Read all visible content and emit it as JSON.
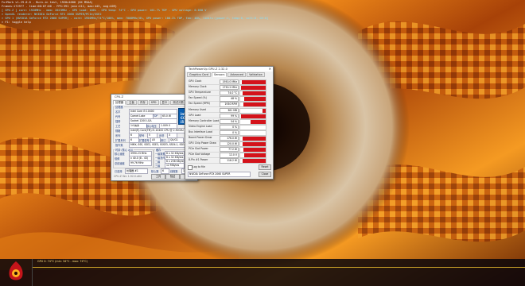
{
  "overlay": [
    {
      "text": "FurMark v1.29.0.0 - Burn-in test, 1920x1080 (0X MSAA)",
      "color": "white"
    },
    {
      "text": "Frames:172977 - time:00:07:00 - FPS:391 (min:411, max:443, avg:409)",
      "color": "white"
    },
    {
      "text": "[ GPU-Z ] core: 1920MHz - mem: 2023MHz - GPU load: 100% - GPU temp: 74°C - GPU power: 101.7% TDP - GPU voltage: 0.050 V",
      "color": "cyan"
    },
    {
      "text": "> OpenGL renderer: NVIDIA GeForce RTX 2060 SUPER/PCIe/SSE2",
      "color": "cyan"
    },
    {
      "text": "> GPU 1 (NVIDIA GeForce RTX 2060 SUPER) - core: 1950MHz/74°C/100%, mem: 7000MHz/0%, GPU power: 100.2% TDP, fan: 48%, limits:[power:1, temp:0, volt:0, OV:0]",
      "color": "cyan"
    },
    {
      "text": "> F1: toggle help",
      "color": "white"
    }
  ],
  "cpuz": {
    "title": "CPU-Z",
    "tabs": [
      "处理器",
      "主板",
      "内存",
      "SPD",
      "显卡",
      "测试分数",
      "关于"
    ],
    "active_tab": "处理器",
    "processor_group": "处理器",
    "name_label": "名字",
    "name_value": "Intel Core i5 10400",
    "codename_label": "代号",
    "codename_value": "Comet Lake",
    "tdp_label": "TDP",
    "tdp_value": "65.0 W",
    "package_label": "插槽",
    "package_value": "Socket 1200 LGA",
    "tech_label": "工艺",
    "tech_value": "14 纳米",
    "voltage_label": "核心电压",
    "voltage_value": "1.009 V",
    "spec_label": "规格",
    "spec_value": "Intel(R) Core(TM) i5-10400 CPU @ 2.90GHz (ES)",
    "family_label": "系列",
    "family_value": "6",
    "model_label": "型号",
    "model_value": "5",
    "stepping_label": "步进",
    "stepping_value": "3",
    "extfamily_label": "扩展系列",
    "extfamily_value": "6",
    "extmodel_label": "扩展型号",
    "extmodel_value": "A5",
    "revision_label": "修订",
    "revision_value": "Q0/G1",
    "instr_label": "指令集",
    "instr_value": "MMX, SSE, SSE2, SSE3, SSSE3, SSE4.1, SSE4.2, EM64T, VT-x, AES, AVX, AVX2, FMA3",
    "clocks_group": "时钟 (核心 #0)",
    "cache_group": "缓存",
    "core_speed_label": "核心速度",
    "core_speed_value": "3990.23 MHz",
    "multiplier_label": "倍频",
    "multiplier_value": "x 40.0 (8 - 43)",
    "bus_label": "总线速度",
    "bus_value": "99.76 MHz",
    "l1d_label": "一级数据",
    "l1d_value": "6 x 32 KBytes",
    "l1d_way": "8-way",
    "l1i_label": "一级指令",
    "l1i_value": "6 x 32 KBytes",
    "l1i_way": "8-way",
    "l2_label": "二级",
    "l2_value": "6 x 256 KBytes",
    "l2_way": "4-way",
    "l3_label": "三级",
    "l3_value": "12 MBytes",
    "l3_way": "16-way",
    "selected_label": "已选择",
    "selected_value": "处理器 #1",
    "cores_label": "核心数",
    "cores_value": "6",
    "threads_label": "线程数",
    "threads_value": "12",
    "version": "CPU-Z  Ver. 1.92.0.x64",
    "tools_btn": "工具",
    "validate_btn": "验证",
    "ok_btn": "确定",
    "logo_text": "intel CORE i5"
  },
  "gpuz": {
    "title": "TechPowerUp GPU-Z 2.32.0",
    "tabs": [
      "Graphics Card",
      "Sensors",
      "Advanced",
      "Validation"
    ],
    "active_tab": "Sensors",
    "sensors": [
      {
        "name": "GPU Clock",
        "value": "1950.0 MHz",
        "level": 0.95
      },
      {
        "name": "Memory Clock",
        "value": "1750.2 MHz",
        "level": 0.97
      },
      {
        "name": "GPU Temperature",
        "value": "74.0 °C",
        "level": 0.9
      },
      {
        "name": "Fan Speed (%)",
        "value": "48 %",
        "level": 0.85
      },
      {
        "name": "Fan Speed (RPM)",
        "value": "1930 RPM",
        "level": 0.88
      },
      {
        "name": "Memory Used",
        "value": "381 MB",
        "level": 0.12
      },
      {
        "name": "GPU Load",
        "value": "99 %",
        "level": 0.98
      },
      {
        "name": "Memory Controller Load",
        "value": "54 %",
        "level": 0.6
      },
      {
        "name": "Video Engine Load",
        "value": "0 %",
        "level": 0
      },
      {
        "name": "Bus Interface Load",
        "value": "0 %",
        "level": 0
      },
      {
        "name": "Board Power Draw",
        "value": "176.0 W",
        "level": 0.92
      },
      {
        "name": "GPU Chip Power Draw",
        "value": "120.0 W",
        "level": 0.9
      },
      {
        "name": "PCIe Slot Power",
        "value": "77.2 W",
        "level": 0.88
      },
      {
        "name": "PCIe Slot Voltage",
        "value": "12.0 V",
        "level": 0.85
      },
      {
        "name": "8-Pin #1 Power",
        "value": "118.2 W",
        "level": 0.9
      }
    ],
    "log_label": "Log to file",
    "reset_btn": "Reset",
    "card_select": "NVIDIA GeForce RTX 2060 SUPER",
    "close_btn": "Close"
  },
  "status_line": "GPU 0: 74°C (min: 34°C - max: 74°C)"
}
